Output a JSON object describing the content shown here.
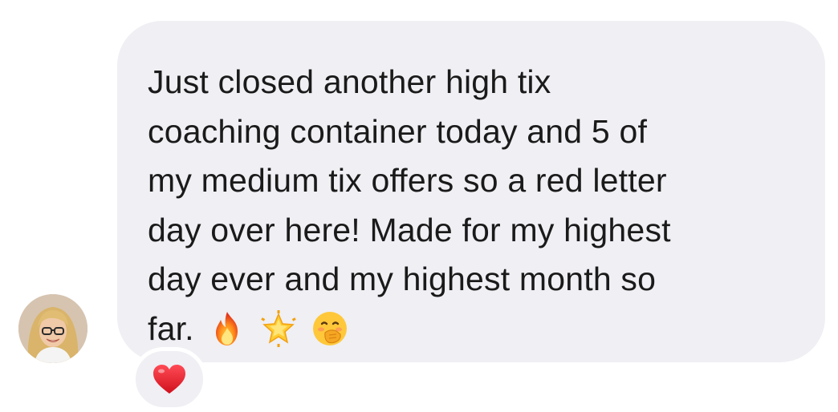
{
  "message": {
    "lines": [
      "Just closed another high tix",
      "coaching container today and 5 of",
      "my medium tix offers so a red letter",
      "day over here!  Made for my highest",
      "day ever and my highest month so",
      "far."
    ],
    "emojis": [
      "fire-emoji",
      "sparkle-star-emoji",
      "hand-over-mouth-emoji"
    ],
    "bubble_color": "#efeff4",
    "text_color": "#1a1a1a"
  },
  "reaction": {
    "icon": "red-heart-icon",
    "color": "#e0232e"
  },
  "avatar": {
    "icon": "user-avatar"
  }
}
